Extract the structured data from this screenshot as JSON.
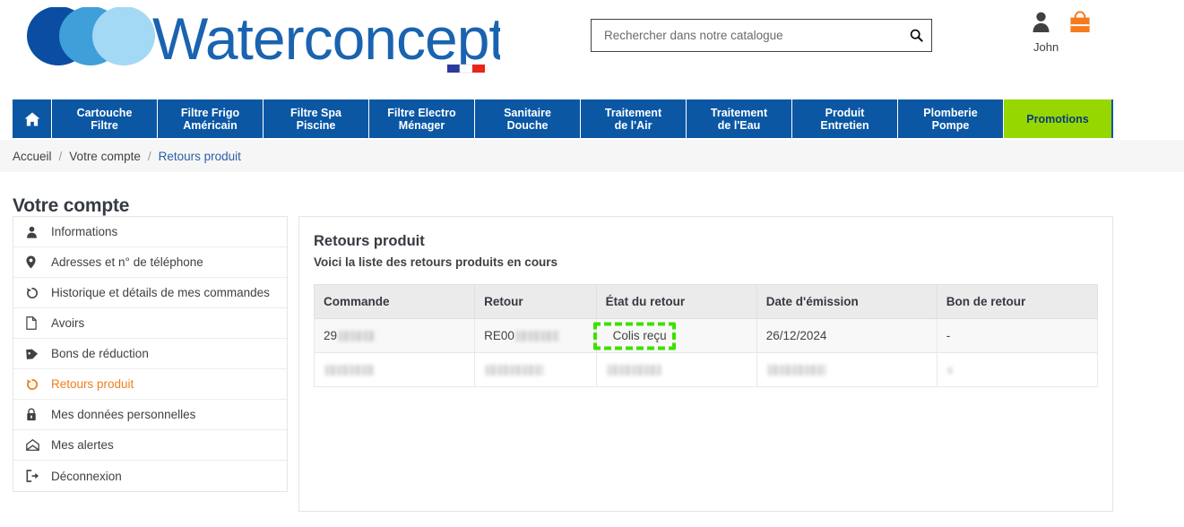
{
  "brand": {
    "name": "Waterconcept",
    "logo_colors": [
      "#0b4da2",
      "#3f9fd9",
      "#a3d9f4"
    ],
    "flag_colors": [
      "#2b3a9c",
      "#ffffff",
      "#e8261c"
    ]
  },
  "search": {
    "placeholder": "Rechercher dans notre catalogue",
    "value": "",
    "icon": "search-icon"
  },
  "account": {
    "user_label": "John",
    "user_icon": "user-icon",
    "cart_icon": "shopping-bag-icon",
    "cart_color": "#f57b20"
  },
  "nav": {
    "home_icon": "home-icon",
    "accent_promo_bg": "#96d700",
    "bg": "#0b57a4",
    "items": [
      {
        "label_line1": "Cartouche",
        "label_line2": "Filtre"
      },
      {
        "label_line1": "Filtre Frigo",
        "label_line2": "Américain"
      },
      {
        "label_line1": "Filtre Spa",
        "label_line2": "Piscine"
      },
      {
        "label_line1": "Filtre Electro",
        "label_line2": "Ménager"
      },
      {
        "label_line1": "Sanitaire",
        "label_line2": "Douche"
      },
      {
        "label_line1": "Traitement",
        "label_line2": "de l'Air"
      },
      {
        "label_line1": "Traitement",
        "label_line2": "de l'Eau"
      },
      {
        "label_line1": "Produit",
        "label_line2": "Entretien"
      },
      {
        "label_line1": "Plomberie",
        "label_line2": "Pompe"
      }
    ],
    "promo": {
      "label": "Promotions"
    }
  },
  "breadcrumb": {
    "items": [
      {
        "label": "Accueil",
        "current": false
      },
      {
        "label": "Votre compte",
        "current": false
      },
      {
        "label": "Retours produit",
        "current": true
      }
    ],
    "separator": "/"
  },
  "page": {
    "title": "Votre compte"
  },
  "sidebar": {
    "items": [
      {
        "label": "Informations",
        "icon": "user-icon",
        "active": false
      },
      {
        "label": "Adresses et n° de téléphone",
        "icon": "map-pin-icon",
        "active": false
      },
      {
        "label": "Historique et détails de mes commandes",
        "icon": "history-icon",
        "active": false
      },
      {
        "label": "Avoirs",
        "icon": "document-icon",
        "active": false
      },
      {
        "label": "Bons de réduction",
        "icon": "tag-icon",
        "active": false
      },
      {
        "label": "Retours produit",
        "icon": "return-arrow-icon",
        "active": true
      },
      {
        "label": "Mes données personnelles",
        "icon": "lock-icon",
        "active": false
      },
      {
        "label": "Mes alertes",
        "icon": "envelope-icon",
        "active": false
      },
      {
        "label": "Déconnexion",
        "icon": "logout-icon",
        "active": false
      }
    ],
    "active_color": "#ef7f1a"
  },
  "main": {
    "title": "Retours produit",
    "subtitle": "Voici la liste des retours produits en cours",
    "table": {
      "headers": [
        "Commande",
        "Retour",
        "État du retour",
        "Date d'émission",
        "Bon de retour"
      ],
      "rows": [
        {
          "commande": "29",
          "commande_redacted": true,
          "retour": "RE00",
          "retour_redacted": true,
          "etat": "Colis reçu",
          "etat_highlighted": true,
          "date": "26/12/2024",
          "bon": "-"
        },
        {
          "commande": "",
          "commande_redacted": true,
          "retour": "",
          "retour_redacted": true,
          "etat": "",
          "etat_highlighted": false,
          "date": "",
          "bon": ""
        }
      ]
    },
    "annotation": {
      "type": "dashed-highlight-box",
      "color": "#3ee000",
      "target": "Colis reçu"
    }
  }
}
